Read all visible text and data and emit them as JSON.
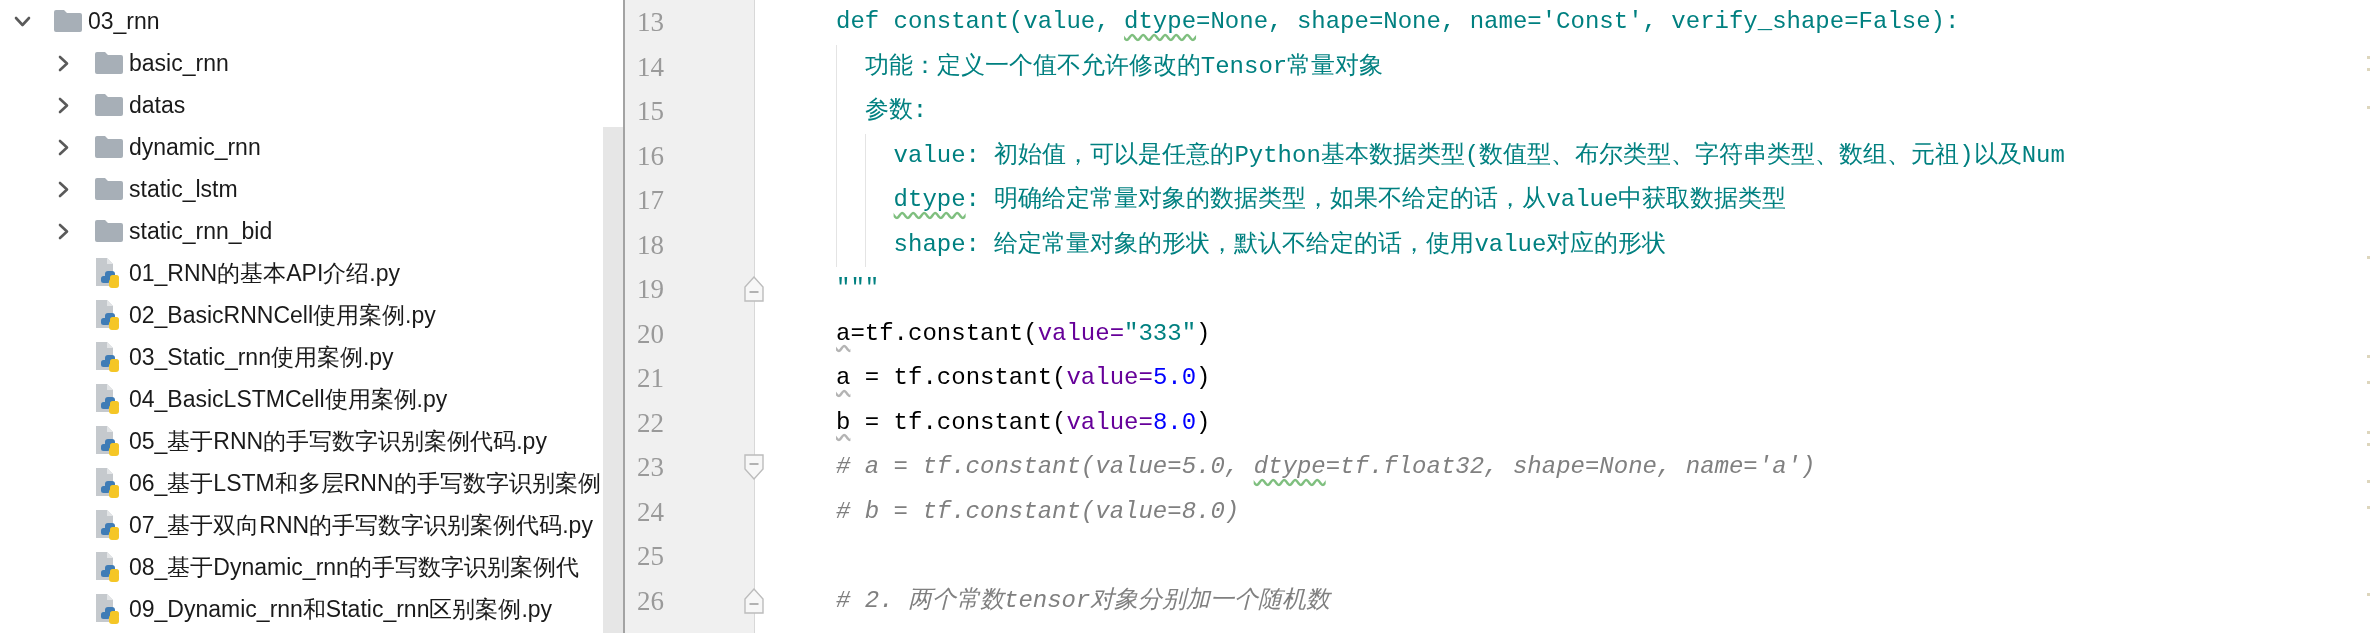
{
  "project_tree": {
    "items": [
      {
        "kind": "folder",
        "label": "03_rnn",
        "expanded": true,
        "children": [
          {
            "kind": "folder",
            "label": "basic_rnn",
            "expanded": false
          },
          {
            "kind": "folder",
            "label": "datas",
            "expanded": false
          },
          {
            "kind": "folder",
            "label": "dynamic_rnn",
            "expanded": false
          },
          {
            "kind": "folder",
            "label": "static_lstm",
            "expanded": false
          },
          {
            "kind": "folder",
            "label": "static_rnn_bid",
            "expanded": false
          },
          {
            "kind": "file",
            "label": "01_RNN的基本API介绍.py"
          },
          {
            "kind": "file",
            "label": "02_BasicRNNCell使用案例.py"
          },
          {
            "kind": "file",
            "label": "03_Static_rnn使用案例.py"
          },
          {
            "kind": "file",
            "label": "04_BasicLSTMCell使用案例.py"
          },
          {
            "kind": "file",
            "label": "05_基于RNN的手写数字识别案例代码.py"
          },
          {
            "kind": "file",
            "label": "06_基于LSTM和多层RNN的手写数字识别案例"
          },
          {
            "kind": "file",
            "label": "07_基于双向RNN的手写数字识别案例代码.py"
          },
          {
            "kind": "file",
            "label": "08_基于Dynamic_rnn的手写数字识别案例代"
          },
          {
            "kind": "file",
            "label": "09_Dynamic_rnn和Static_rnn区别案例.py"
          }
        ]
      }
    ]
  },
  "editor": {
    "lines": [
      {
        "number": "13",
        "tokens": [
          {
            "kind": "docstring",
            "text": "def constant(value, "
          },
          {
            "kind": "docstring",
            "text": "dtype",
            "flagged": true
          },
          {
            "kind": "docstring",
            "text": "=None, shape=None, name='Const', verify_shape=False):"
          }
        ],
        "children": [
          {
            "number": "14",
            "tokens": [
              {
                "kind": "docstring",
                "text": "功能：定义一个值不允许修改的Tensor常量对象"
              }
            ]
          },
          {
            "number": "15",
            "tokens": [
              {
                "kind": "docstring",
                "text": "参数:"
              }
            ],
            "children": [
              {
                "number": "16",
                "tokens": [
                  {
                    "kind": "docstring",
                    "text": "value: 初始值，可以是任意的Python基本数据类型(数值型、布尔类型、字符串类型、数组、元祖)以及Num"
                  }
                ]
              },
              {
                "number": "17",
                "tokens": [
                  {
                    "kind": "docstring",
                    "text": "dtype",
                    "flagged": true
                  },
                  {
                    "kind": "docstring",
                    "text": ": 明确给定常量对象的数据类型，如果不给定的话，从value中获取数据类型"
                  }
                ]
              },
              {
                "number": "18",
                "tokens": [
                  {
                    "kind": "docstring",
                    "text": "shape: 给定常量对象的形状，默认不给定的话，使用value对应的形状"
                  }
                ]
              }
            ]
          }
        ]
      },
      {
        "number": "19",
        "fold_end": true,
        "tokens": [
          {
            "kind": "docstring",
            "text": "\"\"\""
          }
        ]
      },
      {
        "number": "20",
        "tokens": [
          {
            "kind": "plain",
            "text": "a",
            "flagged": true
          },
          {
            "kind": "plain",
            "text": "=tf.constant("
          },
          {
            "kind": "param",
            "text": "value="
          },
          {
            "kind": "string",
            "text": "\"333\""
          },
          {
            "kind": "plain",
            "text": ")"
          }
        ]
      },
      {
        "number": "21",
        "tokens": [
          {
            "kind": "plain",
            "text": "a",
            "flagged": true
          },
          {
            "kind": "plain",
            "text": " = tf.constant("
          },
          {
            "kind": "param",
            "text": "value="
          },
          {
            "kind": "number",
            "text": "5.0"
          },
          {
            "kind": "plain",
            "text": ")"
          }
        ]
      },
      {
        "number": "22",
        "tokens": [
          {
            "kind": "plain",
            "text": "b",
            "flagged": true
          },
          {
            "kind": "plain",
            "text": " = tf.constant("
          },
          {
            "kind": "param",
            "text": "value="
          },
          {
            "kind": "number",
            "text": "8.0"
          },
          {
            "kind": "plain",
            "text": ")"
          }
        ]
      },
      {
        "number": "23",
        "fold_start": true,
        "tokens": [
          {
            "kind": "comment",
            "text": "# a = tf.constant(value=5.0, "
          },
          {
            "kind": "comment",
            "text": "dtype",
            "flagged": true
          },
          {
            "kind": "comment",
            "text": "=tf.float32, shape=None, name='a')"
          }
        ]
      },
      {
        "number": "24",
        "tokens": [
          {
            "kind": "comment",
            "text": "# b = tf.constant(value=8.0)"
          }
        ]
      },
      {
        "number": "25"
      },
      {
        "number": "26",
        "fold_end": true,
        "tokens": [
          {
            "kind": "comment",
            "text": "# 2. 两个常数tensor对象分别加一个随机数"
          }
        ]
      }
    ]
  }
}
